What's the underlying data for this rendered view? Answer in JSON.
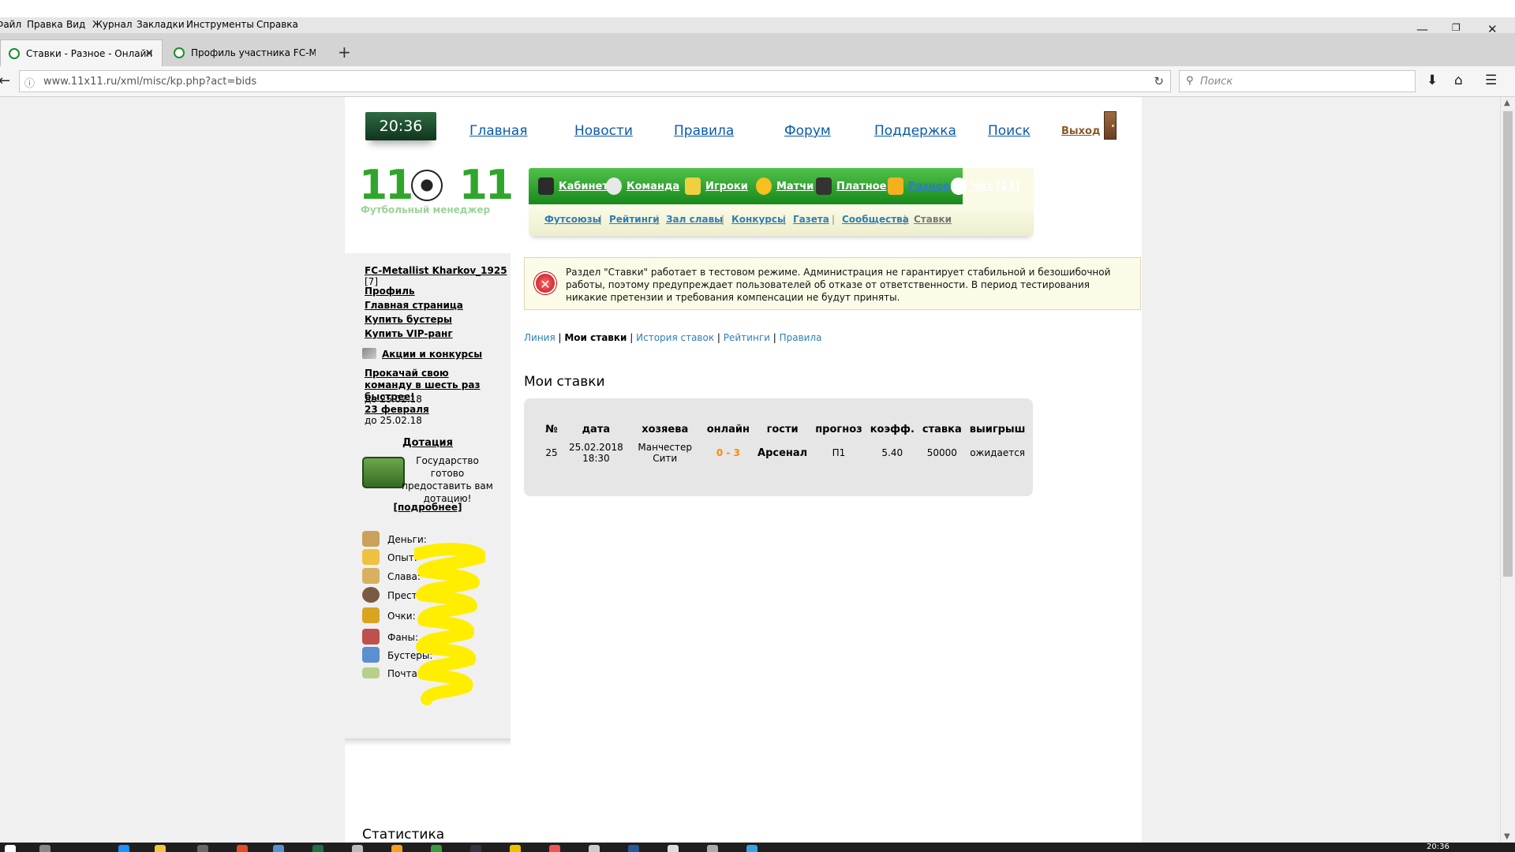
{
  "browser": {
    "menu": [
      "Файл",
      "Правка",
      "Вид",
      "Журнал",
      "Закладки",
      "Инструменты",
      "Справка"
    ],
    "tabs": [
      {
        "title": "Ставки - Разное - Онлайн ..."
      },
      {
        "title": "Профиль участника FC-Me..."
      }
    ],
    "url": "www.11x11.ru/xml/misc/kp.php?act=bids",
    "search_placeholder": "Поиск",
    "icons": {
      "back": "arrow-left",
      "reload": "reload",
      "download": "download",
      "home": "home",
      "menu": "hamburger"
    }
  },
  "header": {
    "clock": "20:36",
    "nav": [
      "Главная",
      "Новости",
      "Правила",
      "Форум",
      "Поддержка",
      "Поиск"
    ],
    "logout": "Выход",
    "logo": {
      "digits": "11⚽11",
      "subtitle": "Футбольный менеджер"
    }
  },
  "green_menu": {
    "items": [
      {
        "label": "Кабинет",
        "icon": "manager-icon"
      },
      {
        "label": "Команда",
        "icon": "stadium-icon"
      },
      {
        "label": "Игроки",
        "icon": "players-icon"
      },
      {
        "label": "Матчи",
        "icon": "trophy-ball-icon"
      },
      {
        "label": "Платное",
        "icon": "coins-icon"
      },
      {
        "label": "Разное",
        "icon": "beer-icon",
        "active": true
      },
      {
        "label": "Чат [23]",
        "icon": "chat-icon"
      }
    ],
    "sub_items": [
      "Футсоюзы",
      "Рейтинги",
      "Зал славы",
      "Конкурсы",
      "Газета",
      "Сообщества",
      "Ставки"
    ]
  },
  "sidebar": {
    "team": "FC-Metallist Kharkov_1925",
    "team_level": "[7]",
    "links": [
      "Профиль",
      "Главная страница",
      "Купить бустеры",
      "Купить VIP-ранг"
    ],
    "promo_link": "Акции и конкурсы",
    "promos": [
      {
        "title": "Прокачай свою команду в шесть раз быстрее!",
        "until": "до 25.02.18"
      },
      {
        "title": "23 февраля",
        "until": "до 25.02.18"
      }
    ],
    "dotation": {
      "title": "Дотация",
      "text": "Государство готово предоставить вам дотацию!",
      "more": "[подробнее]"
    },
    "stats": [
      {
        "label": "Деньги:",
        "icon": "money-bag-icon",
        "color": "#c9a15a"
      },
      {
        "label": "Опыт:",
        "icon": "cheese-icon",
        "color": "#f0c040"
      },
      {
        "label": "Слава:",
        "icon": "podium-icon",
        "color": "#d8b060"
      },
      {
        "label": "Престиж:",
        "icon": "person-icon",
        "color": "#7a5a40"
      },
      {
        "label": "Очки:",
        "icon": "cup-icon",
        "color": "#d9a520"
      },
      {
        "label": "Фаны:",
        "icon": "fans-icon",
        "color": "#c0504d"
      },
      {
        "label": "Бустеры:",
        "icon": "booster-icon",
        "color": "#5a8fd0"
      },
      {
        "label": "Почта:",
        "icon": "envelope-icon",
        "color": "#b7d08a"
      }
    ]
  },
  "warning": {
    "text": "Раздел \"Ставки\" работает в тестовом режиме. Администрация не гарантирует стабильной и безошибочной работы, поэтому предупреждает пользователей об отказе от ответственности. В период тестирования никакие претензии и требования компенсации не будут приняты."
  },
  "subnav": [
    "Линия",
    "Мои ставки",
    "История ставок",
    "Рейтинги",
    "Правила"
  ],
  "bets": {
    "title": "Мои ставки",
    "columns": [
      "№",
      "дата",
      "хозяева",
      "онлайн",
      "гости",
      "прогноз",
      "коэфф.",
      "ставка",
      "выигрыш"
    ],
    "rows": [
      {
        "num": "25",
        "date": "25.02.2018",
        "time": "18:30",
        "home": "Манчестер Сити",
        "online": "0 - 3",
        "guest": "Арсенал",
        "forecast": "П1",
        "coef": "5.40",
        "stake": "50000",
        "win": "ожидается"
      }
    ]
  },
  "footer": {
    "stats_title": "Статистика"
  },
  "taskbar": {
    "clock": "20:36"
  }
}
